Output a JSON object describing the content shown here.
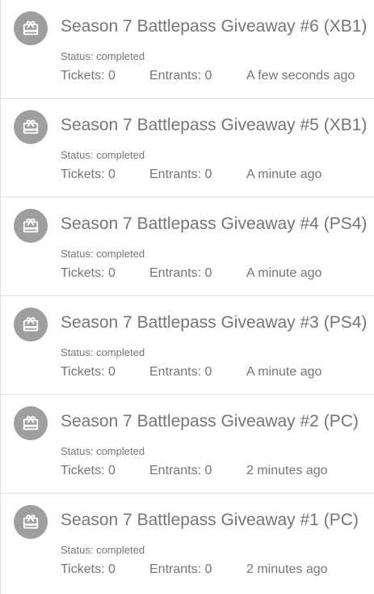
{
  "colors": {
    "avatar_bg": "#9e9e9e",
    "text": "#757575",
    "divider": "#e0e0e0"
  },
  "icon": "gift-card-icon",
  "giveaways": [
    {
      "title": "Season 7 Battlepass Giveaway #6 (XB1)",
      "status": "Status: completed",
      "tickets": "Tickets: 0",
      "entrants": "Entrants: 0",
      "time": "A few seconds ago"
    },
    {
      "title": "Season 7 Battlepass Giveaway #5 (XB1)",
      "status": "Status: completed",
      "tickets": "Tickets: 0",
      "entrants": "Entrants: 0",
      "time": "A minute ago"
    },
    {
      "title": "Season 7 Battlepass Giveaway #4 (PS4)",
      "status": "Status: completed",
      "tickets": "Tickets: 0",
      "entrants": "Entrants: 0",
      "time": "A minute ago"
    },
    {
      "title": "Season 7 Battlepass Giveaway #3 (PS4)",
      "status": "Status: completed",
      "tickets": "Tickets: 0",
      "entrants": "Entrants: 0",
      "time": "A minute ago"
    },
    {
      "title": "Season 7 Battlepass Giveaway #2 (PC)",
      "status": "Status: completed",
      "tickets": "Tickets: 0",
      "entrants": "Entrants: 0",
      "time": "2 minutes ago"
    },
    {
      "title": "Season 7 Battlepass Giveaway #1 (PC)",
      "status": "Status: completed",
      "tickets": "Tickets: 0",
      "entrants": "Entrants: 0",
      "time": "2 minutes ago"
    }
  ]
}
